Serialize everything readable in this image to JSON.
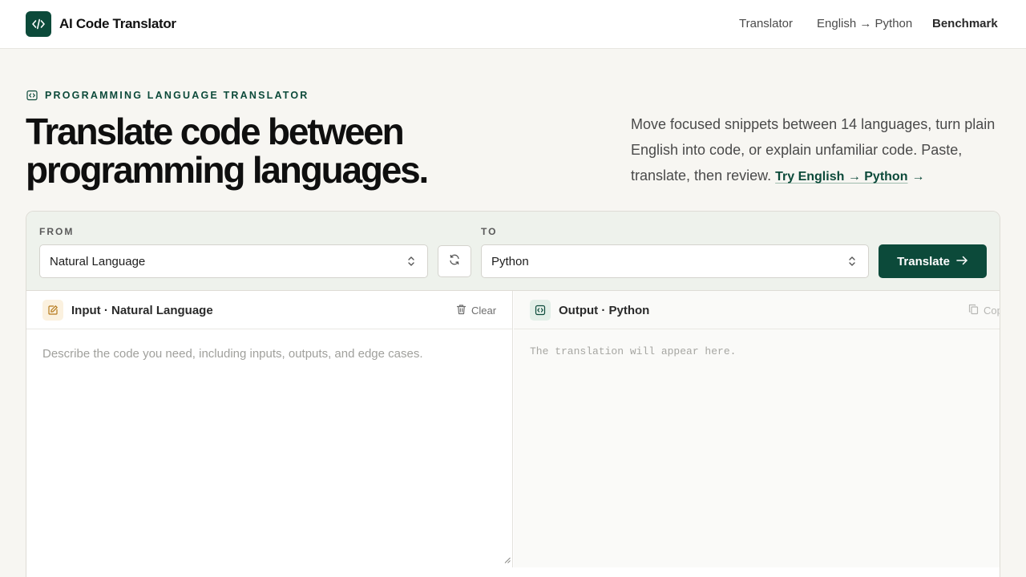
{
  "app": {
    "title": "AI Code Translator"
  },
  "nav": [
    {
      "label": "Translator"
    },
    {
      "label": "English → Python"
    },
    {
      "label": "Benchmark"
    }
  ],
  "hero": {
    "eyebrow": "PROGRAMMING LANGUAGE TRANSLATOR",
    "title": "Translate code between programming languages.",
    "description": "Move focused snippets between 14 languages, turn plain English into code, or explain unfamiliar code. Paste, translate, then review.",
    "cta": "Try English → Python",
    "cta_arrow": "→"
  },
  "controls": {
    "from_label": "FROM",
    "from_value": "Natural Language",
    "to_label": "TO",
    "to_value": "Python",
    "translate_label": "Translate"
  },
  "input": {
    "title": "Input · Natural Language",
    "clear_label": "Clear",
    "placeholder": "Describe the code you need, including inputs, outputs, and edge cases.",
    "value": ""
  },
  "output": {
    "title": "Output · Python",
    "copy_label": "Copy",
    "placeholder": "The translation will appear here."
  },
  "colors": {
    "accent": "#0c4a3a",
    "page_bg": "#f7f6f2",
    "controls_bg": "#eef2ec"
  }
}
